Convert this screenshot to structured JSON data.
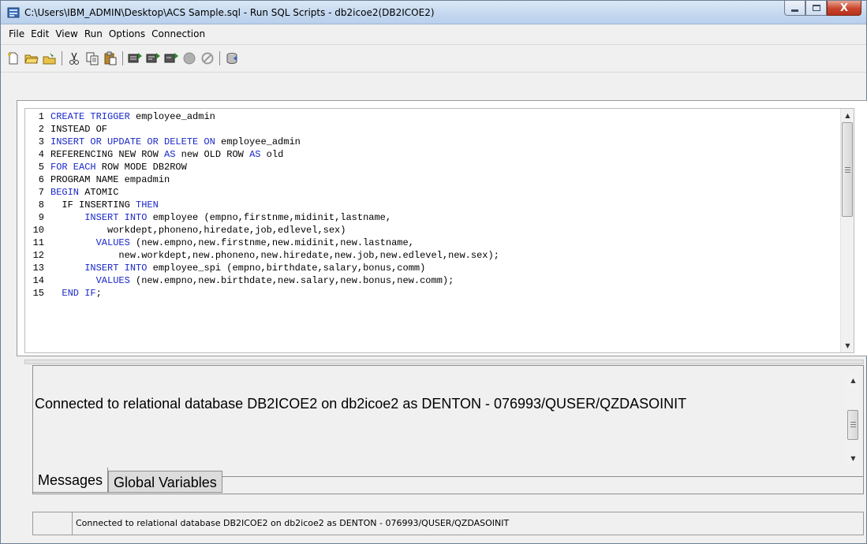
{
  "window": {
    "title": "C:\\Users\\IBM_ADMIN\\Desktop\\ACS Sample.sql - Run SQL Scripts - db2icoe2(DB2ICOE2)",
    "app_icon": "database-script-icon",
    "close_glyph": "X"
  },
  "menu": {
    "items": [
      "File",
      "Edit",
      "View",
      "Run",
      "Options",
      "Connection"
    ]
  },
  "toolbar": {
    "buttons": [
      "new-icon",
      "open-icon",
      "save-icon",
      "cut-icon",
      "copy-icon",
      "paste-icon",
      "run-all-icon",
      "run-from-selected-icon",
      "run-selected-icon",
      "stop-icon",
      "cancel-icon",
      "connection-icon"
    ]
  },
  "editor": {
    "lines": [
      {
        "n": "1",
        "parts": [
          {
            "t": "CREATE TRIGGER",
            "kw": true
          },
          {
            "t": " employee_admin",
            "kw": false
          }
        ]
      },
      {
        "n": "2",
        "parts": [
          {
            "t": "INSTEAD OF",
            "kw": false
          }
        ]
      },
      {
        "n": "3",
        "parts": [
          {
            "t": "INSERT OR UPDATE OR DELETE ON",
            "kw": true
          },
          {
            "t": " employee_admin",
            "kw": false
          }
        ]
      },
      {
        "n": "4",
        "parts": [
          {
            "t": "REFERENCING NEW ROW ",
            "kw": false
          },
          {
            "t": "AS",
            "kw": true
          },
          {
            "t": " new OLD ROW ",
            "kw": false
          },
          {
            "t": "AS",
            "kw": true
          },
          {
            "t": " old",
            "kw": false
          }
        ]
      },
      {
        "n": "5",
        "parts": [
          {
            "t": "FOR EACH",
            "kw": true
          },
          {
            "t": " ROW MODE DB2ROW",
            "kw": false
          }
        ]
      },
      {
        "n": "6",
        "parts": [
          {
            "t": "PROGRAM NAME empadmin",
            "kw": false
          }
        ]
      },
      {
        "n": "7",
        "parts": [
          {
            "t": "BEGIN",
            "kw": true
          },
          {
            "t": " ATOMIC",
            "kw": false
          }
        ]
      },
      {
        "n": "8",
        "parts": [
          {
            "t": "  IF INSERTING ",
            "kw": false
          },
          {
            "t": "THEN",
            "kw": true
          }
        ]
      },
      {
        "n": "9",
        "parts": [
          {
            "t": "      ",
            "kw": false
          },
          {
            "t": "INSERT INTO",
            "kw": true
          },
          {
            "t": " employee (empno,firstnme,midinit,lastname,",
            "kw": false
          }
        ]
      },
      {
        "n": "10",
        "parts": [
          {
            "t": "          workdept,phoneno,hiredate,job,edlevel,sex)",
            "kw": false
          }
        ]
      },
      {
        "n": "11",
        "parts": [
          {
            "t": "        ",
            "kw": false
          },
          {
            "t": "VALUES",
            "kw": true
          },
          {
            "t": " (new.empno,new.firstnme,new.midinit,new.lastname,",
            "kw": false
          }
        ]
      },
      {
        "n": "12",
        "parts": [
          {
            "t": "            new.workdept,new.phoneno,new.hiredate,new.job,new.edlevel,new.sex);",
            "kw": false
          }
        ]
      },
      {
        "n": "13",
        "parts": [
          {
            "t": "      ",
            "kw": false
          },
          {
            "t": "INSERT INTO",
            "kw": true
          },
          {
            "t": " employee_spi (empno,birthdate,salary,bonus,comm)",
            "kw": false
          }
        ]
      },
      {
        "n": "14",
        "parts": [
          {
            "t": "        ",
            "kw": false
          },
          {
            "t": "VALUES",
            "kw": true
          },
          {
            "t": " (new.empno,new.birthdate,new.salary,new.bonus,new.comm);",
            "kw": false
          }
        ]
      },
      {
        "n": "15",
        "parts": [
          {
            "t": "  ",
            "kw": false
          },
          {
            "t": "END IF",
            "kw": true
          },
          {
            "t": ";",
            "kw": false
          }
        ]
      }
    ],
    "keyword_color": "#1a28c8"
  },
  "messages": {
    "text": "Connected to relational database DB2ICOE2 on db2icoe2 as DENTON - 076993/QUSER/QZDASOINIT",
    "tabs": [
      {
        "label": "Messages",
        "active": true
      },
      {
        "label": "Global Variables",
        "active": false
      }
    ]
  },
  "status": {
    "text": "Connected to relational database DB2ICOE2 on db2icoe2 as DENTON - 076993/QUSER/QZDASOINIT"
  }
}
